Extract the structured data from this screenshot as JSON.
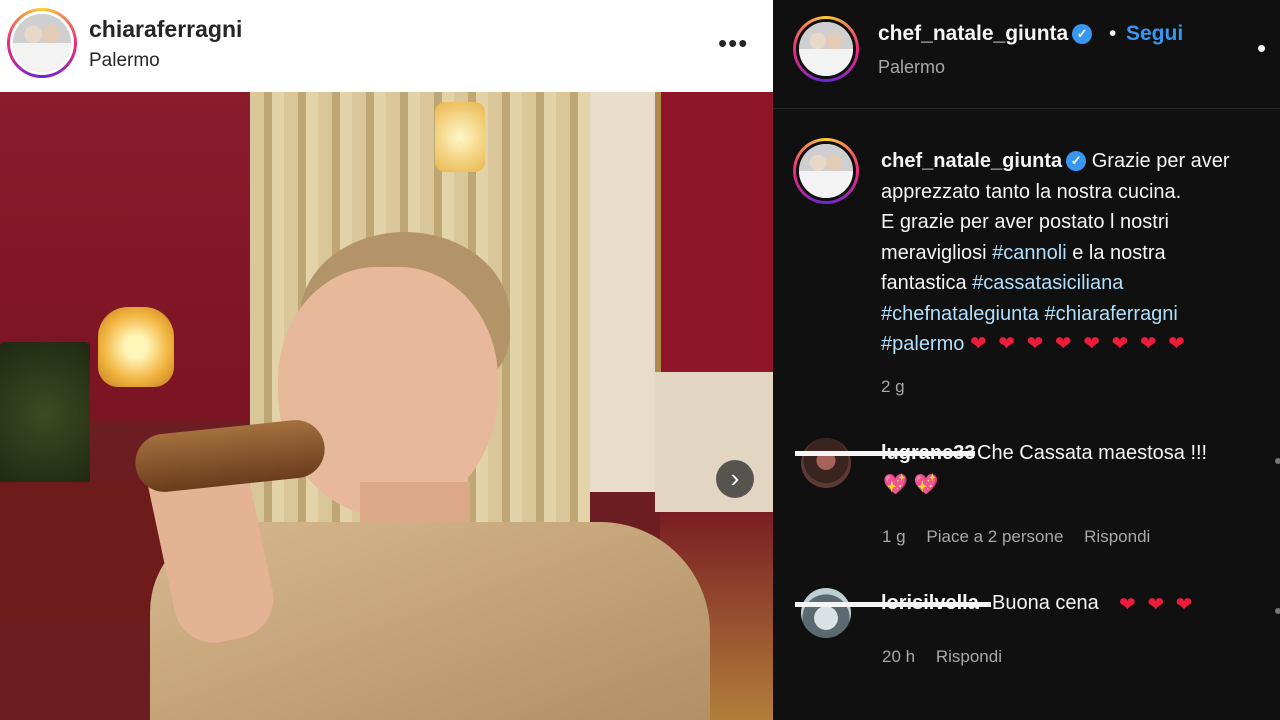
{
  "left_post": {
    "username": "chiaraferragni",
    "location": "Palermo",
    "more_label": "•••",
    "next_label": "›"
  },
  "right_post": {
    "username": "chef_natale_giunta",
    "verified_mark": "✓",
    "separator": "•",
    "follow_label": "Segui",
    "location": "Palermo",
    "more_label": "•"
  },
  "caption": {
    "username": "chef_natale_giunta",
    "lines": [
      "Grazie per aver",
      "apprezzato tanto la nostra cucina.",
      "E grazie per aver postato l nostri",
      "meravigliosi ",
      "#cannoli",
      " e la nostra",
      "fantastica ",
      "#cassatasiciliana",
      "#chefnatalegiunta #chiaraferragni",
      "#palermo",
      "❤ ❤ ❤ ❤ ❤ ❤ ❤ ❤"
    ],
    "time": "2 g"
  },
  "comments": [
    {
      "username": "lugrane33",
      "text": "Che Cassata maestosa !!!",
      "emoji": "💖 💖",
      "time": "1 g",
      "likes": "Piace a 2 persone",
      "reply": "Rispondi"
    },
    {
      "username": "lorisilvella",
      "text": "Buona cena",
      "emoji": "❤ ❤ ❤",
      "time": "20 h",
      "reply": "Rispondi"
    }
  ],
  "colors": {
    "accent_blue": "#3897f0",
    "heart_red": "#ed1c3a",
    "panel_dark": "#101010"
  }
}
